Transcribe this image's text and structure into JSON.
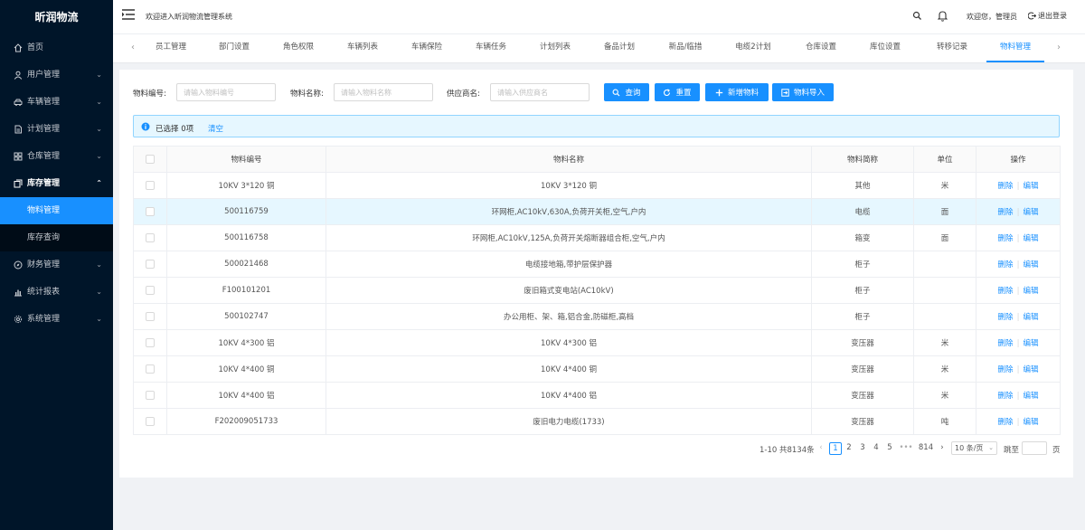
{
  "app": {
    "logo": "昕润物流",
    "welcome": "欢迎进入昕润物流管理系统",
    "greeting": "欢迎您，管理员",
    "logout": "退出登录"
  },
  "sidebar": {
    "items": [
      {
        "label": "首页"
      },
      {
        "label": "用户管理"
      },
      {
        "label": "车辆管理"
      },
      {
        "label": "计划管理"
      },
      {
        "label": "仓库管理"
      },
      {
        "label": "库存管理"
      },
      {
        "label": "财务管理"
      },
      {
        "label": "统计报表"
      },
      {
        "label": "系统管理"
      }
    ],
    "sub_items": [
      {
        "label": "物料管理"
      },
      {
        "label": "库存查询"
      }
    ]
  },
  "tabs": [
    {
      "label": "员工管理"
    },
    {
      "label": "部门设置"
    },
    {
      "label": "角色权限"
    },
    {
      "label": "车辆列表"
    },
    {
      "label": "车辆保险"
    },
    {
      "label": "车辆任务"
    },
    {
      "label": "计划列表"
    },
    {
      "label": "备品计划"
    },
    {
      "label": "新品/临措"
    },
    {
      "label": "电缆2计划"
    },
    {
      "label": "仓库设置"
    },
    {
      "label": "库位设置"
    },
    {
      "label": "转移记录"
    },
    {
      "label": "物料管理"
    }
  ],
  "filters": {
    "code_label": "物料编号:",
    "code_placeholder": "请输入物料编号",
    "name_label": "物料名称:",
    "name_placeholder": "请输入物料名称",
    "supplier_label": "供应商名:",
    "supplier_placeholder": "请输入供应商名"
  },
  "buttons": {
    "query": "查询",
    "reset": "重置",
    "add": "新增物料",
    "import": "物料导入"
  },
  "selection": {
    "text": "已选择 0项",
    "clear": "清空"
  },
  "table": {
    "headers": [
      "物料编号",
      "物料名称",
      "物料简称",
      "单位",
      "操作"
    ],
    "delete_label": "删除",
    "edit_label": "编辑",
    "rows": [
      {
        "code": "10KV 3*120 铜",
        "name": "10KV 3*120 铜",
        "short": "其他",
        "unit": "米"
      },
      {
        "code": "500116759",
        "name": "环网柜,AC10kV,630A,负荷开关柜,空气,户内",
        "short": "电缆",
        "unit": "面"
      },
      {
        "code": "500116758",
        "name": "环网柜,AC10kV,125A,负荷开关熔断器组合柜,空气,户内",
        "short": "箱变",
        "unit": "面"
      },
      {
        "code": "500021468",
        "name": "电缆接地箱,带护层保护器",
        "short": "柜子",
        "unit": ""
      },
      {
        "code": "F100101201",
        "name": "废旧箱式变电站(AC10kV)",
        "short": "柜子",
        "unit": ""
      },
      {
        "code": "500102747",
        "name": "办公用柜、架、箱,铝合金,防磁柜,高档",
        "short": "柜子",
        "unit": ""
      },
      {
        "code": "10KV 4*300 铝",
        "name": "10KV 4*300 铝",
        "short": "变压器",
        "unit": "米"
      },
      {
        "code": "10KV 4*400 铜",
        "name": "10KV 4*400 铜",
        "short": "变压器",
        "unit": "米"
      },
      {
        "code": "10KV 4*400 铝",
        "name": "10KV 4*400 铝",
        "short": "变压器",
        "unit": "米"
      },
      {
        "code": "F202009051733",
        "name": "废旧电力电缆(1733)",
        "short": "变压器",
        "unit": "吨"
      }
    ]
  },
  "pagination": {
    "summary": "1-10 共8134条",
    "pages": [
      "1",
      "2",
      "3",
      "4",
      "5",
      "•••",
      "814"
    ],
    "page_size": "10 条/页",
    "jump_label": "跳至",
    "page_unit": "页"
  }
}
